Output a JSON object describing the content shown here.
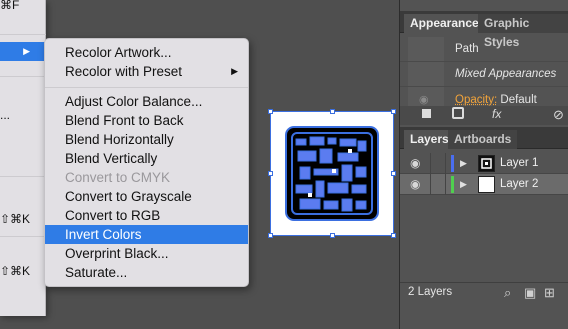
{
  "parent_menu": {
    "rows": [
      {
        "text": "⌘F",
        "arrow": ""
      },
      {
        "text": "",
        "arrow": "▶",
        "highlight": true
      },
      {
        "text": "...",
        "arrow": ""
      },
      {
        "text": "⇧⌘K",
        "arrow": ""
      },
      {
        "text": "⇧⌘K",
        "arrow": ""
      }
    ]
  },
  "submenu": {
    "items": [
      {
        "label": "Recolor Artwork...",
        "state": "enabled"
      },
      {
        "label": "Recolor with Preset",
        "state": "enabled",
        "arrow": "▶"
      },
      {
        "label": "Adjust Color Balance...",
        "state": "enabled"
      },
      {
        "label": "Blend Front to Back",
        "state": "enabled"
      },
      {
        "label": "Blend Horizontally",
        "state": "enabled"
      },
      {
        "label": "Blend Vertically",
        "state": "enabled"
      },
      {
        "label": "Convert to CMYK",
        "state": "disabled"
      },
      {
        "label": "Convert to Grayscale",
        "state": "enabled"
      },
      {
        "label": "Convert to RGB",
        "state": "enabled"
      },
      {
        "label": "Invert Colors",
        "state": "highlighted"
      },
      {
        "label": "Overprint Black...",
        "state": "enabled"
      },
      {
        "label": "Saturate...",
        "state": "enabled"
      }
    ]
  },
  "panel": {
    "appearance_tabs": [
      "Appearance",
      "Graphic Styles"
    ],
    "appearance": {
      "object_type": "Path",
      "mixed": "Mixed Appearances",
      "opacity_label": "Opacity:",
      "opacity_value": "Default",
      "fx_label": "fx"
    },
    "layers_tabs": [
      "Layers",
      "Artboards"
    ],
    "layers": [
      {
        "name": "Layer 1",
        "color": "#4a6ef0"
      },
      {
        "name": "Layer 2",
        "color": "#4fcf4f"
      }
    ],
    "footer_text": "2 Layers"
  },
  "colors": {
    "highlight": "#2f7ce6",
    "selection": "#3b6fe0",
    "opacity_accent": "#f3a43a"
  }
}
